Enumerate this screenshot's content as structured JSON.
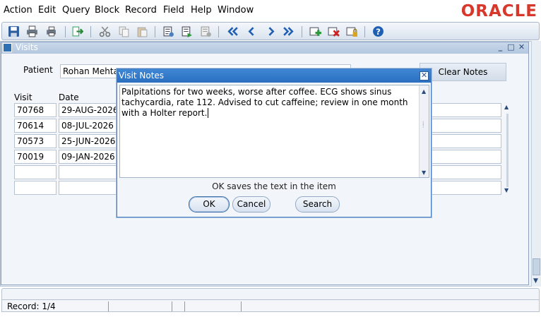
{
  "menu": [
    "Action",
    "Edit",
    "Query",
    "Block",
    "Record",
    "Field",
    "Help",
    "Window"
  ],
  "brand": "ORACLE",
  "colors": {
    "brand": "#d8372b",
    "dialog_title": "#2a6fc0"
  },
  "toolbar_icons": [
    "save-icon",
    "print-icon",
    "print-setup-icon",
    "exit-icon",
    "cut-icon",
    "copy-icon",
    "paste-icon",
    "enter-query-icon",
    "execute-query-icon",
    "cancel-query-icon",
    "first-record-icon",
    "previous-record-icon",
    "next-record-icon",
    "last-record-icon",
    "insert-record-icon",
    "delete-record-icon",
    "lock-record-icon",
    "help-icon"
  ],
  "window": {
    "title": "Visits"
  },
  "patient": {
    "label": "Patient",
    "value": "Rohan Mehta"
  },
  "clear_notes_label": "Clear Notes",
  "table": {
    "headers": [
      "Visit",
      "Date"
    ],
    "rows": [
      {
        "visit": "70768",
        "date": "29-AUG-2026"
      },
      {
        "visit": "70614",
        "date": "08-JUL-2026"
      },
      {
        "visit": "70573",
        "date": "25-JUN-2026"
      },
      {
        "visit": "70019",
        "date": "09-JAN-2026"
      },
      {
        "visit": "",
        "date": ""
      },
      {
        "visit": "",
        "date": ""
      }
    ]
  },
  "dialog": {
    "title": "Visit Notes",
    "text": "Palpitations for two weeks, worse after coffee. ECG shows sinus tachycardia, rate 112. Advised to cut caffeine; review in one month with a Holter report.",
    "hint": "OK saves the text in the item",
    "ok_label": "OK",
    "cancel_label": "Cancel",
    "search_label": "Search"
  },
  "status": {
    "record": "Record: 1/4"
  }
}
